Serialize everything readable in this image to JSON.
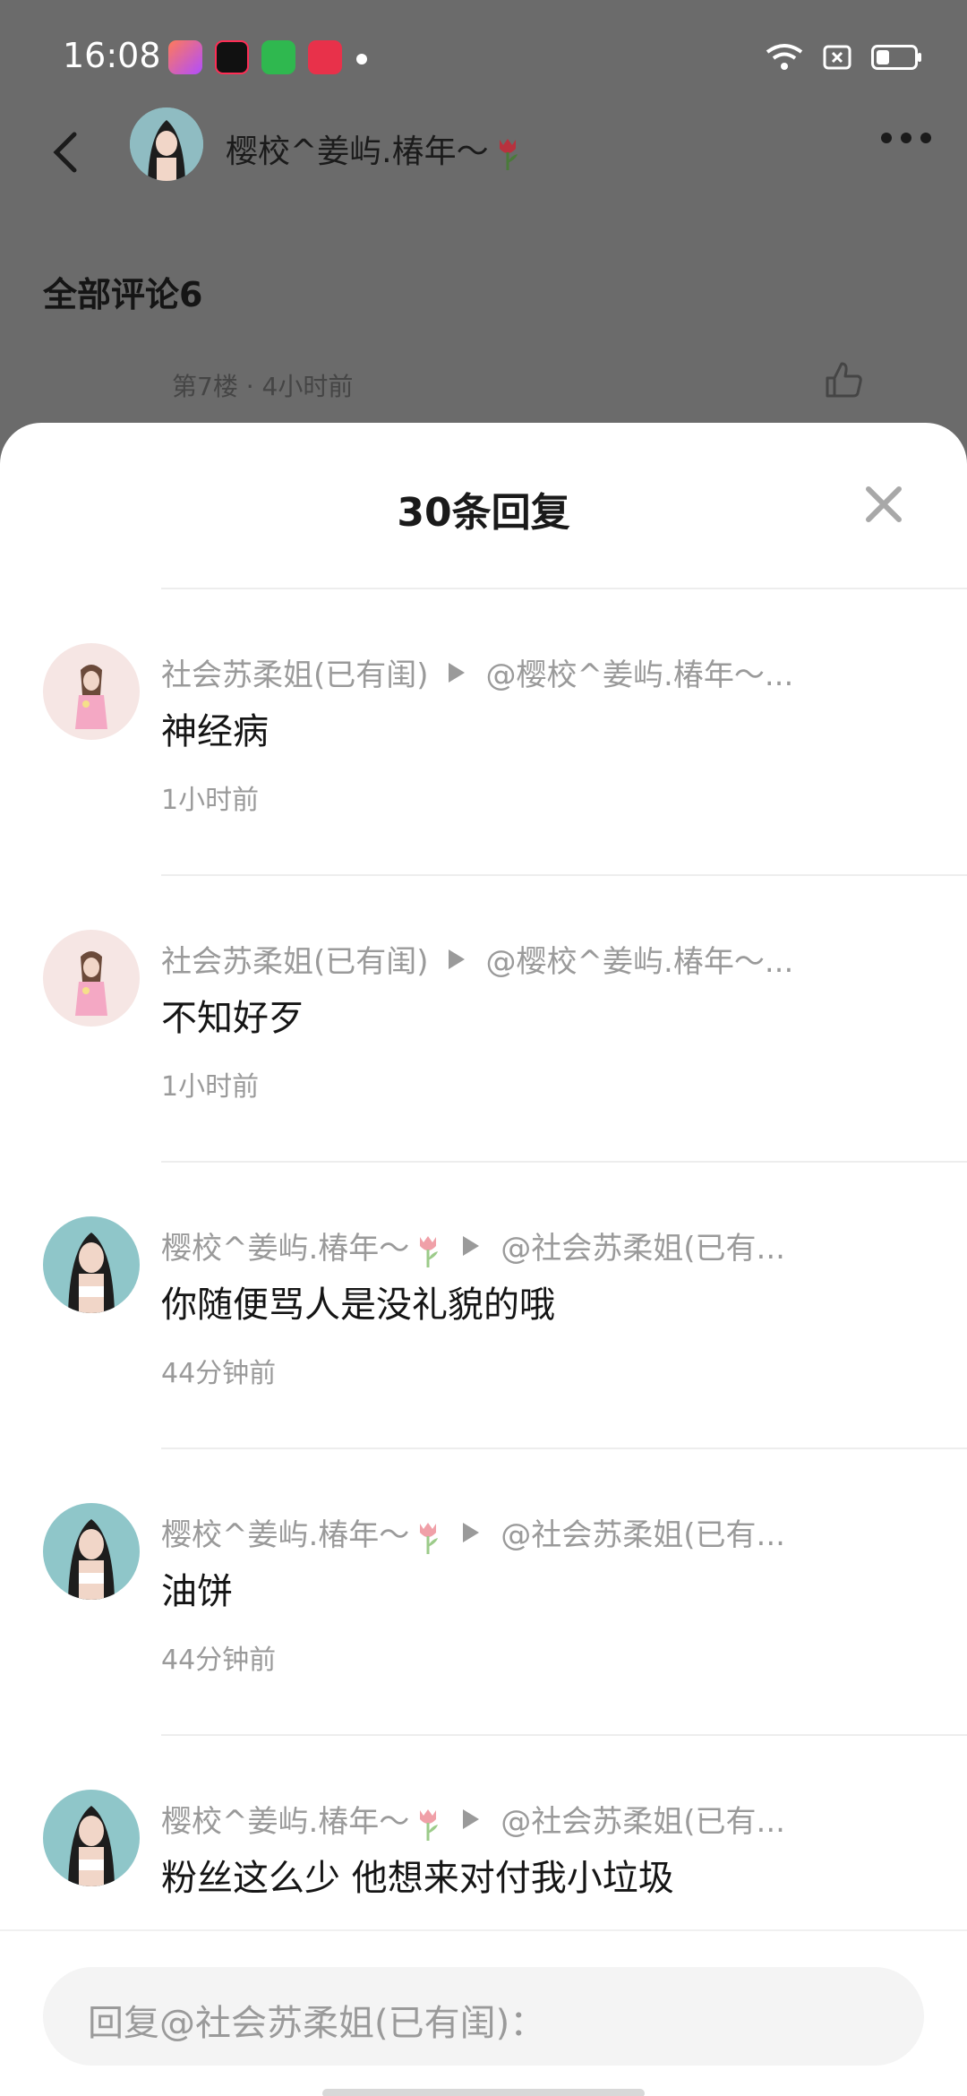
{
  "status_bar": {
    "time": "16:08",
    "battery_level": 0.35
  },
  "header": {
    "name": "樱校^姜屿.椿年～"
  },
  "background": {
    "comments_title": "全部评论6",
    "floor_meta": "第7楼 · 4小时前"
  },
  "sheet": {
    "title": "30条回复",
    "replies": [
      {
        "author": "社会苏柔姐(已有闺)",
        "target": "@樱校^姜屿.椿年～...",
        "text": "神经病",
        "time": "1小时前"
      },
      {
        "author": "社会苏柔姐(已有闺)",
        "target": "@樱校^姜屿.椿年～...",
        "text": "不知好歹",
        "time": "1小时前"
      },
      {
        "author": "樱校^姜屿.椿年～",
        "target": "@社会苏柔姐(已有...",
        "text": "你随便骂人是没礼貌的哦",
        "time": "44分钟前"
      },
      {
        "author": "樱校^姜屿.椿年～",
        "target": "@社会苏柔姐(已有...",
        "text": "油饼",
        "time": "44分钟前"
      },
      {
        "author": "樱校^姜屿.椿年～",
        "target": "@社会苏柔姐(已有...",
        "text": "粉丝这么少 他想来对付我小垃圾",
        "time": ""
      }
    ]
  },
  "input": {
    "placeholder": "回复@社会苏柔姐(已有闺)："
  },
  "colors": {
    "overlay": "#6b6b6b",
    "muted_text": "#9a9a9a",
    "primary_text": "#151515"
  }
}
